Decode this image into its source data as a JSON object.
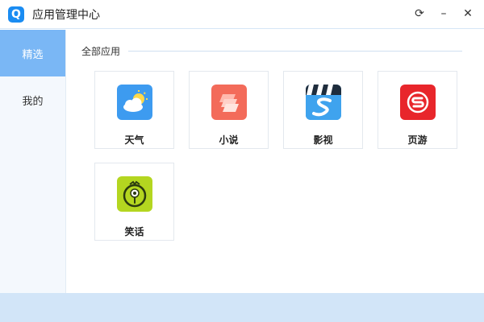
{
  "window": {
    "logo_letter": "Q",
    "title": "应用管理中心",
    "controls": {
      "refresh": "⟳",
      "minimize": "–",
      "close": "✕"
    }
  },
  "sidebar": {
    "items": [
      {
        "label": "精选",
        "active": true
      },
      {
        "label": "我的",
        "active": false
      }
    ]
  },
  "main": {
    "section_title": "全部应用",
    "apps": [
      {
        "label": "天气",
        "icon": "weather-icon",
        "color": "#3d9bf0"
      },
      {
        "label": "小说",
        "icon": "novel-icon",
        "color": "#f36b5a"
      },
      {
        "label": "影视",
        "icon": "video-icon",
        "color": "#2f8fd9"
      },
      {
        "label": "页游",
        "icon": "game-icon",
        "color": "#e8262b"
      },
      {
        "label": "笑话",
        "icon": "joke-icon",
        "color": "#b4d620"
      }
    ]
  },
  "colors": {
    "accent": "#7ab7f5",
    "logo": "#1a8cf2",
    "footer": "#d2e5f8"
  }
}
